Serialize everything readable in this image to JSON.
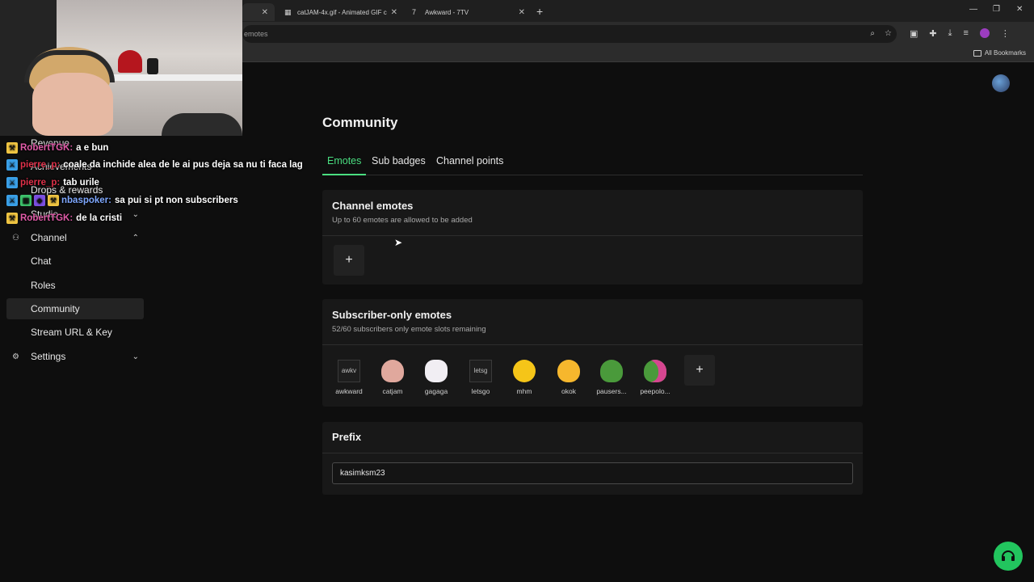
{
  "browser": {
    "tabs": [
      {
        "title": ""
      },
      {
        "title": "catJAM-4x.gif - Animated GIF c"
      },
      {
        "title": "Awkward - 7TV"
      }
    ],
    "url_fragment": "emotes",
    "bookmarks_label": "All Bookmarks"
  },
  "sidebar": {
    "items": [
      {
        "label": "Revenue"
      },
      {
        "label": "Achievements"
      },
      {
        "label": "Drops & rewards"
      },
      {
        "label": "Studio"
      },
      {
        "label": "Channel"
      },
      {
        "label": "Chat"
      },
      {
        "label": "Roles"
      },
      {
        "label": "Community"
      },
      {
        "label": "Stream URL & Key"
      },
      {
        "label": "Settings"
      }
    ]
  },
  "chat": [
    {
      "user": "RobertTGK:",
      "message": "a e bun",
      "color": "#e05ba8"
    },
    {
      "user": "pierre_p:",
      "message": "coale da inchide alea de le ai pus deja sa nu ti faca lag",
      "color": "#e0314a"
    },
    {
      "user": "pierre_p:",
      "message": "tab urile",
      "color": "#e0314a"
    },
    {
      "user": "nbaspoker:",
      "message": "sa pui si pt non subscribers",
      "color": "#7fa8ff"
    },
    {
      "user": "RobertTGK:",
      "message": "de la cristi",
      "color": "#e05ba8"
    }
  ],
  "main": {
    "title": "Community",
    "tabs": [
      {
        "label": "Emotes"
      },
      {
        "label": "Sub badges"
      },
      {
        "label": "Channel points"
      }
    ],
    "channel_emotes": {
      "title": "Channel emotes",
      "subtitle": "Up to 60 emotes are allowed to be added",
      "add_label": "+"
    },
    "subscriber_emotes": {
      "title": "Subscriber-only emotes",
      "subtitle": "52/60 subscribers only emote slots remaining",
      "add_label": "+",
      "emotes": [
        {
          "name": "awkward",
          "alt": "awkv"
        },
        {
          "name": "catjam",
          "alt": ""
        },
        {
          "name": "gagaga",
          "alt": ""
        },
        {
          "name": "letsgo",
          "alt": "letsg"
        },
        {
          "name": "mhm",
          "alt": ""
        },
        {
          "name": "okok",
          "alt": ""
        },
        {
          "name": "pausers...",
          "alt": ""
        },
        {
          "name": "peepolo...",
          "alt": ""
        }
      ]
    },
    "prefix": {
      "title": "Prefix",
      "value": "kasimksm23"
    }
  },
  "colors": {
    "accent": "#4ade80",
    "help_button": "#22c55e"
  }
}
